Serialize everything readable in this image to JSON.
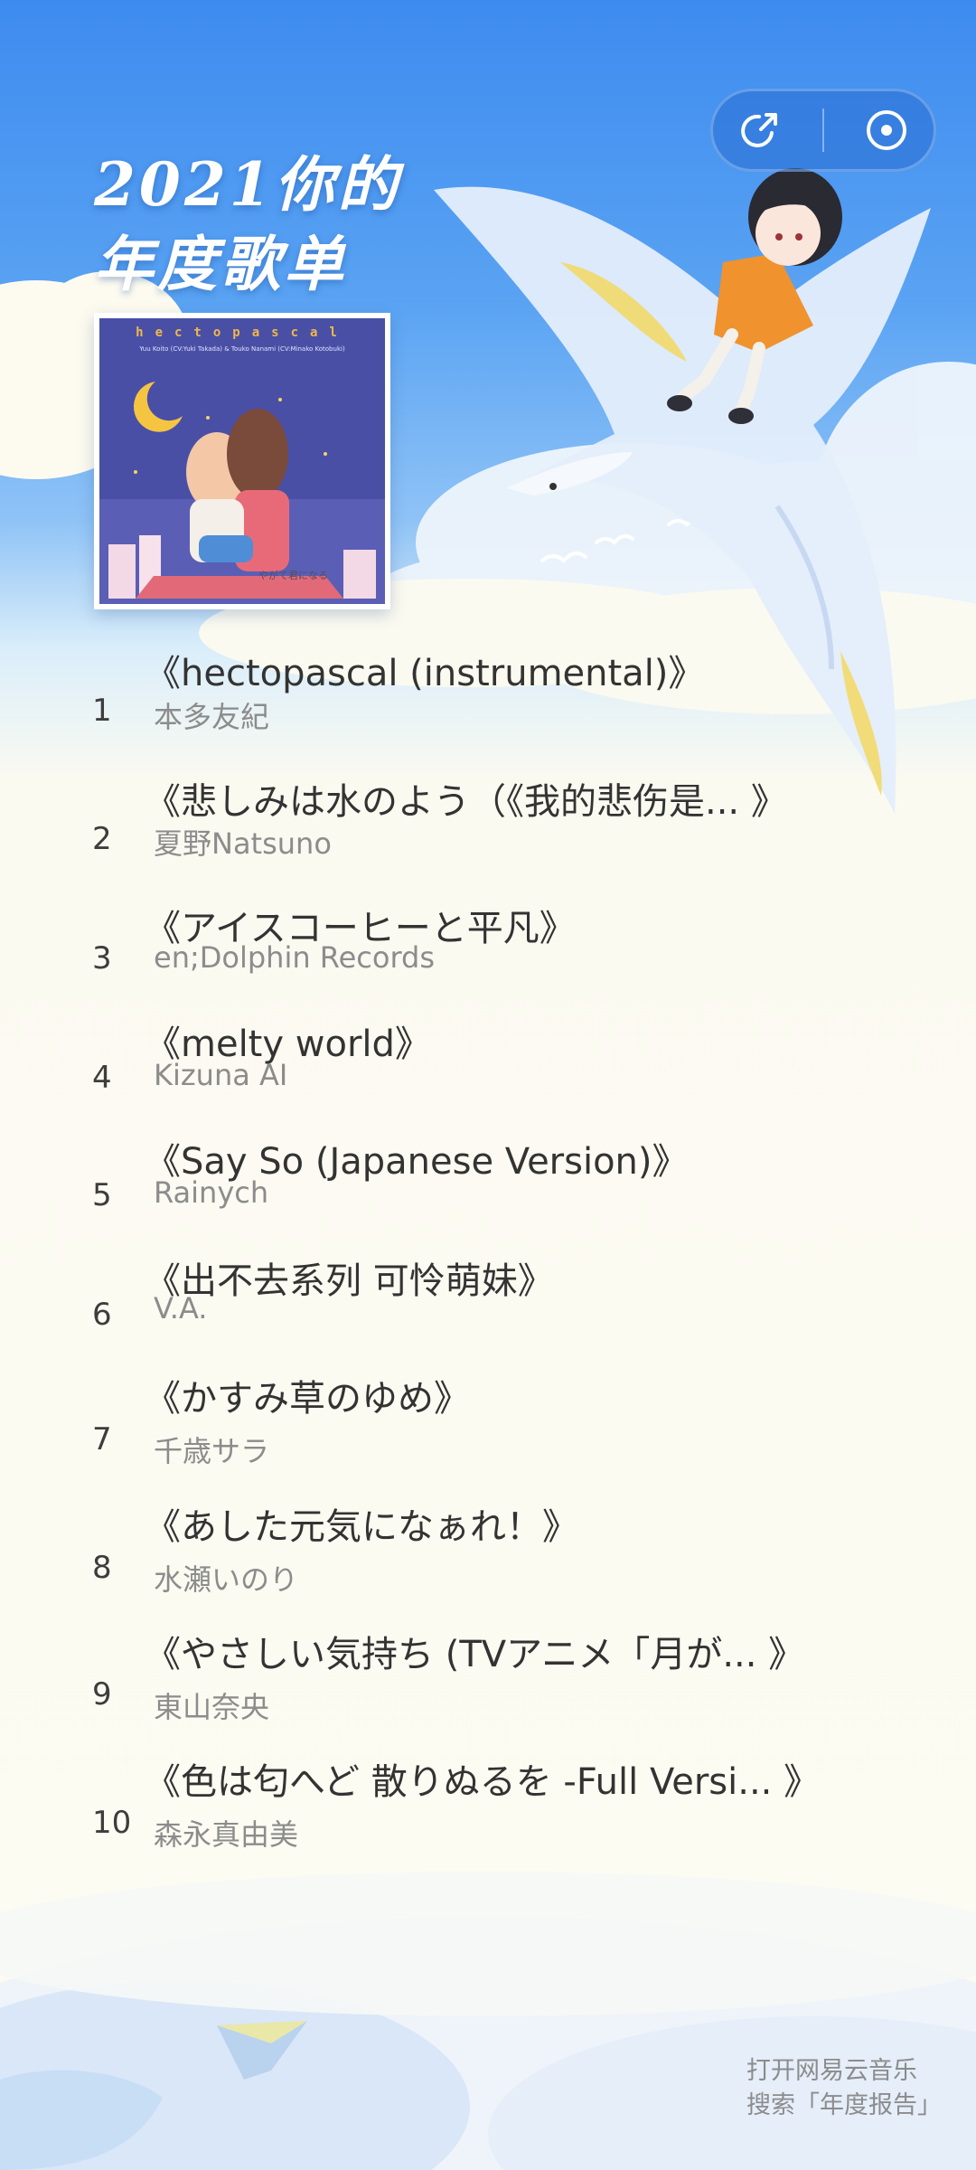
{
  "header": {
    "title_line1": "2021你的",
    "title_line2": "年度歌单",
    "share_icon": "share-icon",
    "record_icon": "record-icon"
  },
  "album": {
    "cover_title": "hectopascal",
    "cover_subtitle": "Yuu Koito (CV:Yuki Takada) & Touko Nanami (CV:Minako Kotobuki)",
    "cover_logo": "やがて君になる"
  },
  "songs": [
    {
      "rank": "1",
      "title": "《hectopascal (instrumental)》",
      "artist": "本多友紀"
    },
    {
      "rank": "2",
      "title": "《悲しみは水のよう（《我的悲伤是... 》",
      "artist": "夏野Natsuno"
    },
    {
      "rank": "3",
      "title": "《アイスコーヒーと平凡》",
      "artist": "en;Dolphin Records"
    },
    {
      "rank": "4",
      "title": "《melty world》",
      "artist": "Kizuna AI"
    },
    {
      "rank": "5",
      "title": "《Say So (Japanese Version)》",
      "artist": "Rainych"
    },
    {
      "rank": "6",
      "title": "《出不去系列 可怜萌妹》",
      "artist": "V.A."
    },
    {
      "rank": "7",
      "title": "《かすみ草のゆめ》",
      "artist": "千歳サラ"
    },
    {
      "rank": "8",
      "title": "《あした元気になぁれ！》",
      "artist": "水瀬いのり"
    },
    {
      "rank": "9",
      "title": "《やさしい気持ち (TVアニメ「月が... 》",
      "artist": "東山奈央"
    },
    {
      "rank": "10",
      "title": "《色は匂へど 散りぬるを -Full Versi... 》",
      "artist": "森永真由美"
    }
  ],
  "footer": {
    "line1": "打开网易云音乐",
    "line2": "搜索「年度报告」"
  },
  "colors": {
    "sky": "#3d8bef",
    "paper": "#fdfcf3",
    "title_text": "#333333",
    "artist_text": "#8c8c8c"
  }
}
